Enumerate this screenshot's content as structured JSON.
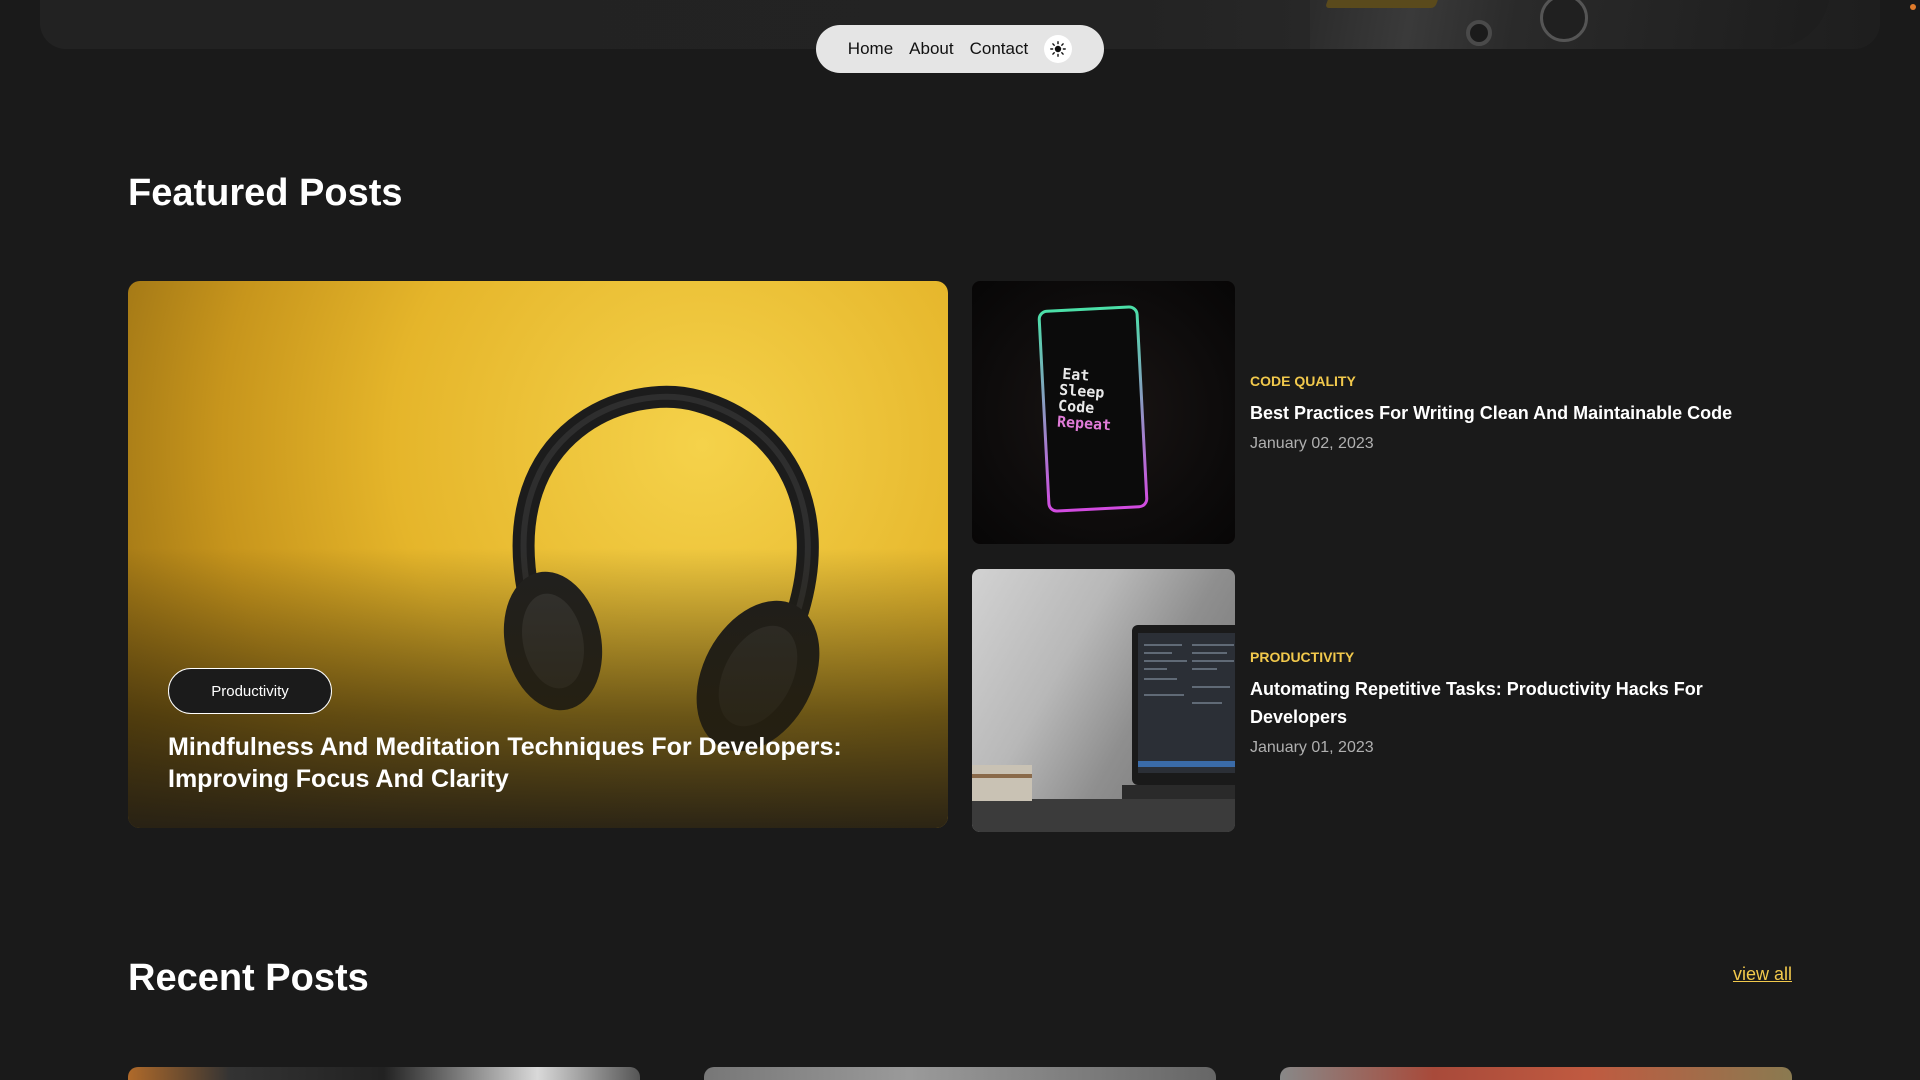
{
  "nav": {
    "links": [
      "Home",
      "About",
      "Contact"
    ]
  },
  "featured": {
    "title": "Featured Posts",
    "main": {
      "category": "Productivity",
      "title": "Mindfulness And Meditation Techniques For Developers: Improving Focus And Clarity",
      "image_icon": "headphones-image"
    },
    "side": [
      {
        "category": "CODE QUALITY",
        "title": "Best Practices For Writing Clean And Maintainable Code",
        "date": "January 02, 2023",
        "image_icon": "phone-image",
        "phone_text": [
          "Eat",
          "Sleep",
          "Code",
          "Repeat"
        ]
      },
      {
        "category": "PRODUCTIVITY",
        "title": "Automating Repetitive Tasks: Productivity Hacks For Developers",
        "date": "January 01, 2023",
        "image_icon": "laptop-image"
      }
    ]
  },
  "recent": {
    "title": "Recent Posts",
    "view_all": "view all"
  },
  "colors": {
    "background": "#1a1a1a",
    "accent": "#f2c94c",
    "nav_bg": "#e5e5e5"
  }
}
